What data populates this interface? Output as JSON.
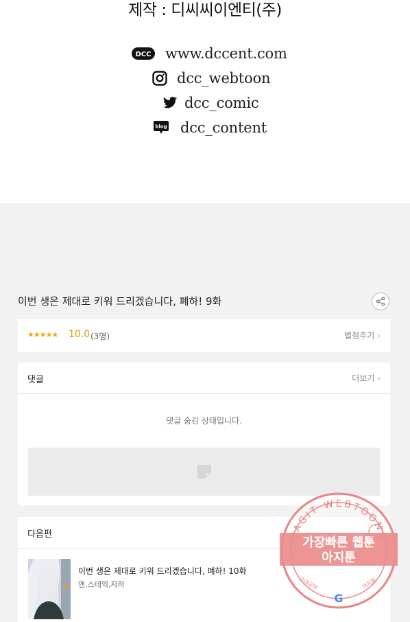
{
  "credits": {
    "title": "제작 : 디씨씨이엔티(주)",
    "website": "www.dccent.com",
    "instagram": "dcc_webtoon",
    "twitter": "dcc_comic",
    "blog": "dcc_content",
    "blog_badge": "blog",
    "dcc_logo": "DCC"
  },
  "episode": {
    "title": "이번 생은 제대로 키워 드리겠습니다, 폐하! 9화",
    "share_icon": "share-icon"
  },
  "rating": {
    "stars": "★★★★★",
    "score": "10.0",
    "count": "(3명)",
    "rate_link": "별점주기",
    "accent": "#e59b00"
  },
  "comments": {
    "label": "댓글",
    "more": "더보기",
    "hidden_message": "댓글 숨김 상태입니다."
  },
  "next": {
    "label": "다음편",
    "title": "이번 생은 제대로 키워 드리겠습니다, 폐하! 10화",
    "authors": "앤,스테익,자하"
  },
  "stamp": {
    "ring_text": "AGIT WEBTOON",
    "line1": "가장빠른 웹툰",
    "line2": "아지툰",
    "bottom_left": "그대공약",
    "bottom_right": "아지툰",
    "google_letter": "G",
    "color": "#e86a6a"
  }
}
